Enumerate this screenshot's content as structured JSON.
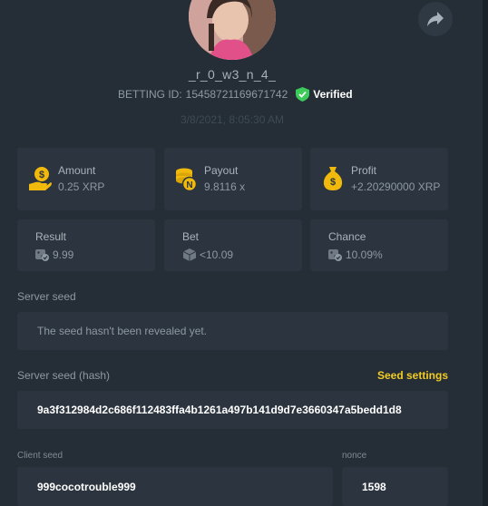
{
  "profile": {
    "username": "_r_0_w3_n_4_",
    "betting_id_label": "BETTING ID:",
    "betting_id": "15458721169671742",
    "verified_label": "Verified",
    "timestamp": "3/8/2021, 8:05:30 AM"
  },
  "stats": {
    "amount": {
      "title": "Amount",
      "value": "0.25 XRP"
    },
    "payout": {
      "title": "Payout",
      "value": "9.8116 x"
    },
    "profit": {
      "title": "Profit",
      "value": "+2.20290000 XRP"
    },
    "result": {
      "title": "Result",
      "value": "9.99"
    },
    "bet": {
      "title": "Bet",
      "value": "<10.09"
    },
    "chance": {
      "title": "Chance",
      "value": "10.09%"
    }
  },
  "seeds": {
    "server_seed_label": "Server seed",
    "server_seed_value": "The seed hasn't been revealed yet.",
    "server_seed_hash_label": "Server seed (hash)",
    "seed_settings_link": "Seed settings",
    "server_seed_hash": "9a3f312984d2c686f112483ffa4b1261a497b141d9d7e3660347a5bedd1d8",
    "client_seed_label": "Client seed",
    "client_seed": "999cocotrouble999",
    "nonce_label": "nonce",
    "nonce": "1598"
  },
  "colors": {
    "background": "#252e37",
    "card": "#2c353f",
    "accent_yellow": "#f2cc23",
    "verified_green": "#3ccb5a",
    "coin_gold": "#f0b90b"
  }
}
